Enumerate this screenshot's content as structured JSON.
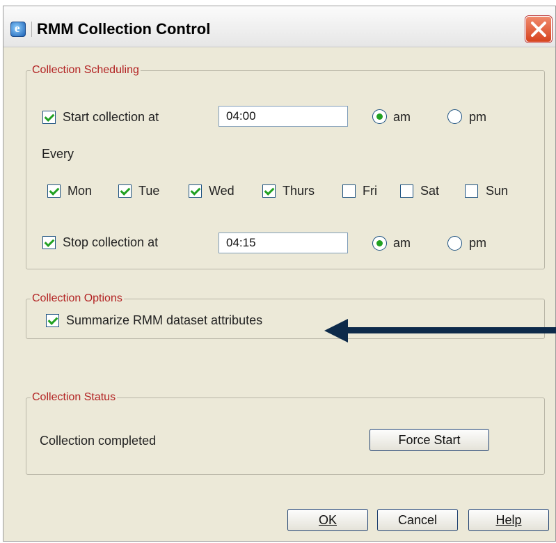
{
  "window": {
    "title": "RMM Collection Control"
  },
  "scheduling": {
    "group_label": "Collection Scheduling",
    "start_label": "Start collection at",
    "start_checked": true,
    "start_time": "04:00",
    "start_ampm": "am",
    "every_label": "Every",
    "days": [
      {
        "label": "Mon",
        "checked": true
      },
      {
        "label": "Tue",
        "checked": true
      },
      {
        "label": "Wed",
        "checked": true
      },
      {
        "label": "Thurs",
        "checked": true
      },
      {
        "label": "Fri",
        "checked": false
      },
      {
        "label": "Sat",
        "checked": false
      },
      {
        "label": "Sun",
        "checked": false
      }
    ],
    "stop_label": "Stop collection at",
    "stop_checked": true,
    "stop_time": "04:15",
    "stop_ampm": "am",
    "am_label": "am",
    "pm_label": "pm"
  },
  "options": {
    "group_label": "Collection Options",
    "summarize_label": "Summarize RMM dataset attributes",
    "summarize_checked": true
  },
  "status": {
    "group_label": "Collection Status",
    "status_text": "Collection completed",
    "force_start_label": "Force Start"
  },
  "footer": {
    "ok_label": "OK",
    "cancel_label": "Cancel",
    "help_label": "Help"
  },
  "colors": {
    "group_label": "#b22222",
    "check": "#21a121",
    "arrow": "#0d2a4a"
  }
}
